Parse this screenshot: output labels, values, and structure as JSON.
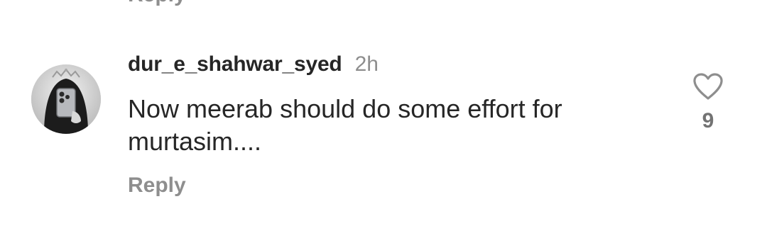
{
  "previous_comment": {
    "reply_label": "Reply"
  },
  "comment": {
    "username": "dur_e_shahwar_syed",
    "time": "2h",
    "text": "Now meerab should do some effort for\nmurtasim....",
    "reply_label": "Reply",
    "like_count": "9",
    "avatar_icon": "avatar-photo",
    "like_icon": "heart-outline-icon"
  },
  "colors": {
    "text_primary": "#262626",
    "text_secondary": "#8e8e8e",
    "like_count": "#737373",
    "background": "#ffffff"
  }
}
